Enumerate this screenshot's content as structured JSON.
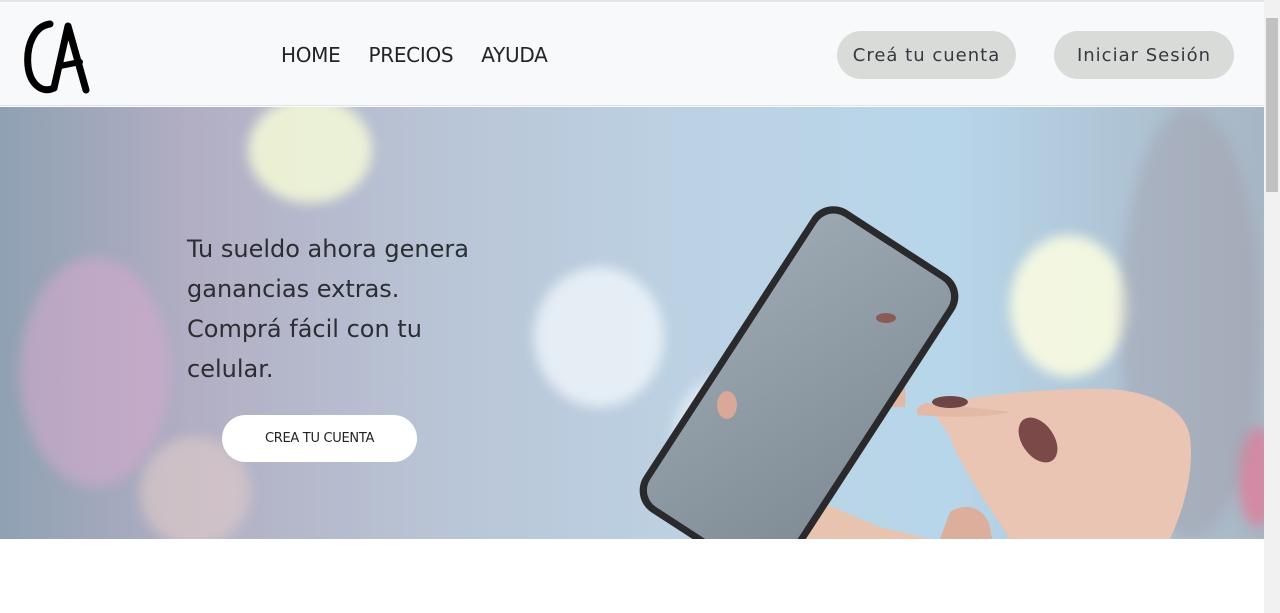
{
  "navbar": {
    "logo_text": "CA",
    "links": [
      {
        "label": "HOME"
      },
      {
        "label": "PRECIOS"
      },
      {
        "label": "AYUDA"
      }
    ],
    "signup_label": "Creá tu cuenta",
    "login_label": "Iniciar Sesión"
  },
  "hero": {
    "lines": [
      "Tu sueldo ahora genera",
      "ganancias extras.",
      "Comprá fácil con tu",
      "celular."
    ],
    "cta_label": "CREA TU CUENTA"
  },
  "colors": {
    "navbar_bg": "#f8f9fa",
    "pill_bg": "#d9dbd8",
    "cta_bg": "#ffffff"
  }
}
